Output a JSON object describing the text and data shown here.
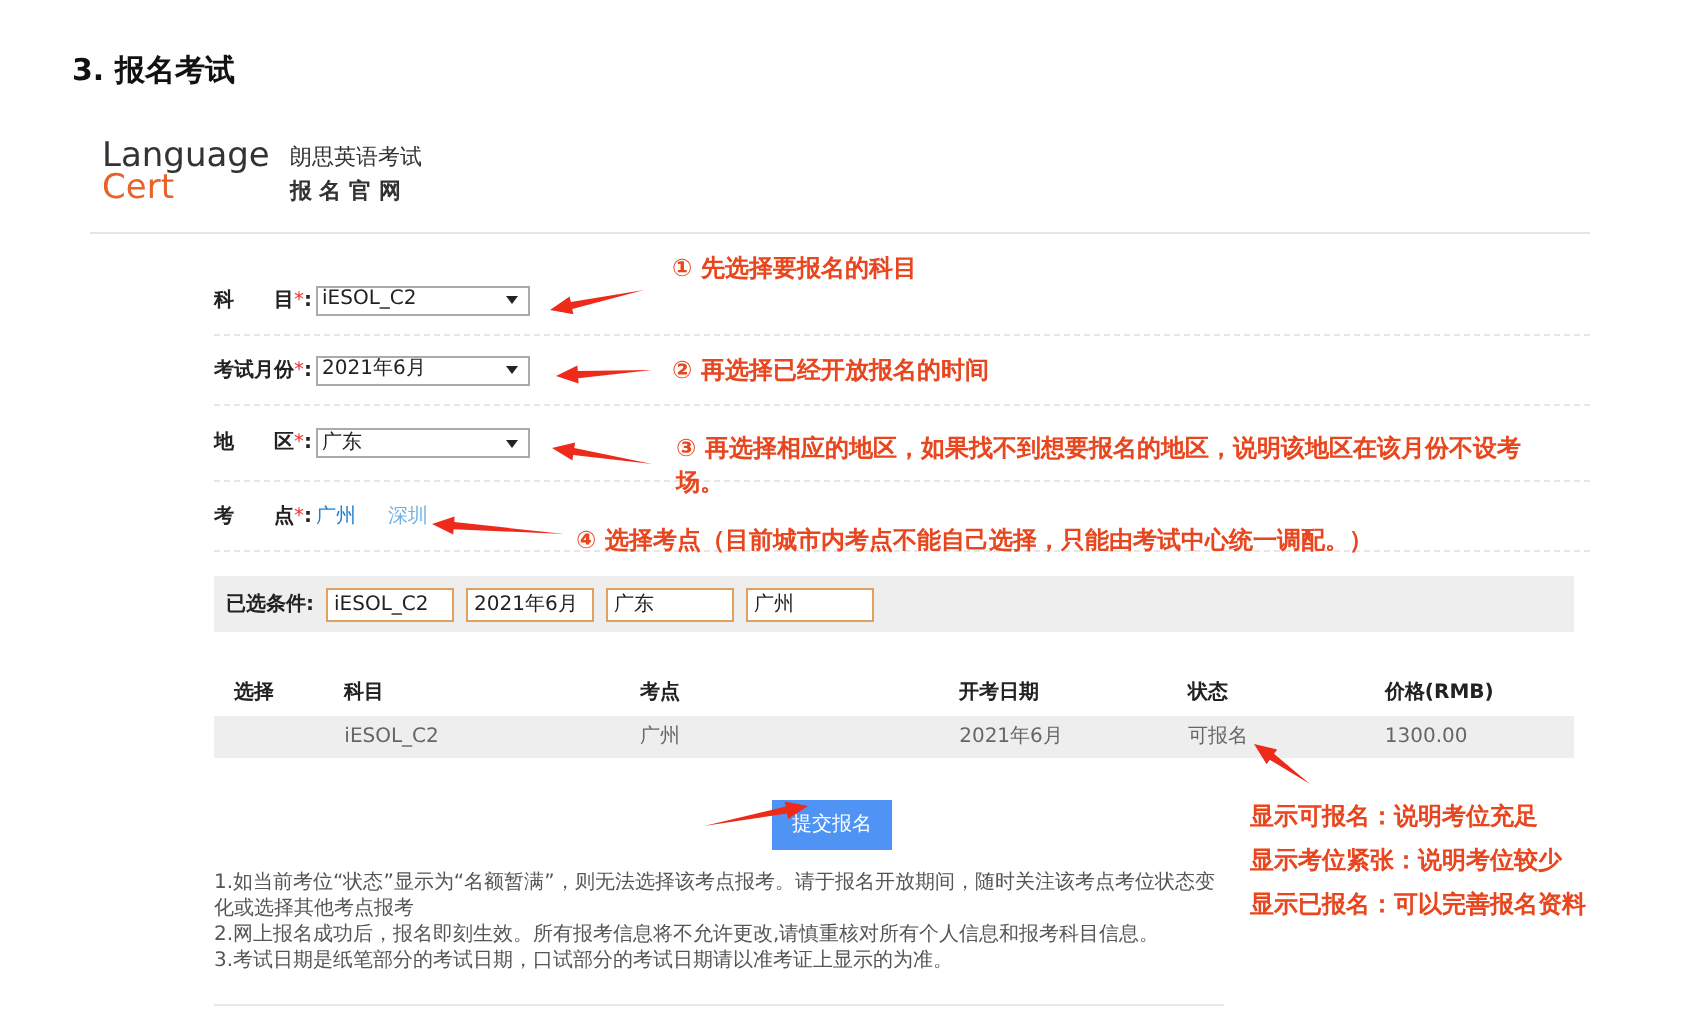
{
  "heading": "3. 报名考试",
  "logo": {
    "word_1": "Language",
    "word_2": "Cert",
    "title": "朗思英语考试",
    "subtitle": "报 名 官 网"
  },
  "form": {
    "fields": [
      {
        "kind": "select",
        "label": "科　　目",
        "mark": "*",
        "colon": ":",
        "value": "iESOL_C2"
      },
      {
        "kind": "select",
        "label": "考试月份",
        "mark": "*",
        "colon": ":",
        "value": "2021年6月"
      },
      {
        "kind": "select",
        "label": "地　　区",
        "mark": "*",
        "colon": ":",
        "value": "广东"
      },
      {
        "kind": "links",
        "label": "考　　点",
        "mark": "*",
        "colon": ":",
        "options": [
          {
            "label": "广州",
            "selected": true
          },
          {
            "label": "深圳",
            "selected": false
          }
        ]
      }
    ]
  },
  "conditions": {
    "label": "已选条件:",
    "values": [
      "iESOL_C2",
      "2021年6月",
      "广东",
      "广州"
    ]
  },
  "table": {
    "columns": [
      "选择",
      "科目",
      "考点",
      "开考日期",
      "状态",
      "价格(RMB)"
    ],
    "rows": [
      {
        "cells": [
          "",
          "iESOL_C2",
          "广州",
          "2021年6月",
          "可报名",
          "1300.00"
        ]
      }
    ]
  },
  "submit_button": "提交报名",
  "notes": [
    "1.如当前考位“状态”显示为“名额暂满”，则无法选择该考点报考。请于报名开放期间，随时关注该考点考位状态变化或选择其他考点报考",
    "2.网上报名成功后，报名即刻生效。所有报考信息将不允许更改,请慎重核对所有个人信息和报考科目信息。",
    "3.考试日期是纸笔部分的考试日期，口试部分的考试日期请以准考证上显示的为准。"
  ],
  "annotations": [
    "① 先选择要报名的科目",
    "② 再选择已经开放报名的时间",
    "③ 再选择相应的地区，如果找不到想要报名的地区，说明该地区在该月份不设考场。",
    "④ 选择考点（目前城市内考点不能自己选择，只能由考试中心统一调配。）",
    "显示可报名：说明考位充足",
    "显示考位紧张：说明考位较少",
    "显示已报名：可以完善报名资料"
  ]
}
